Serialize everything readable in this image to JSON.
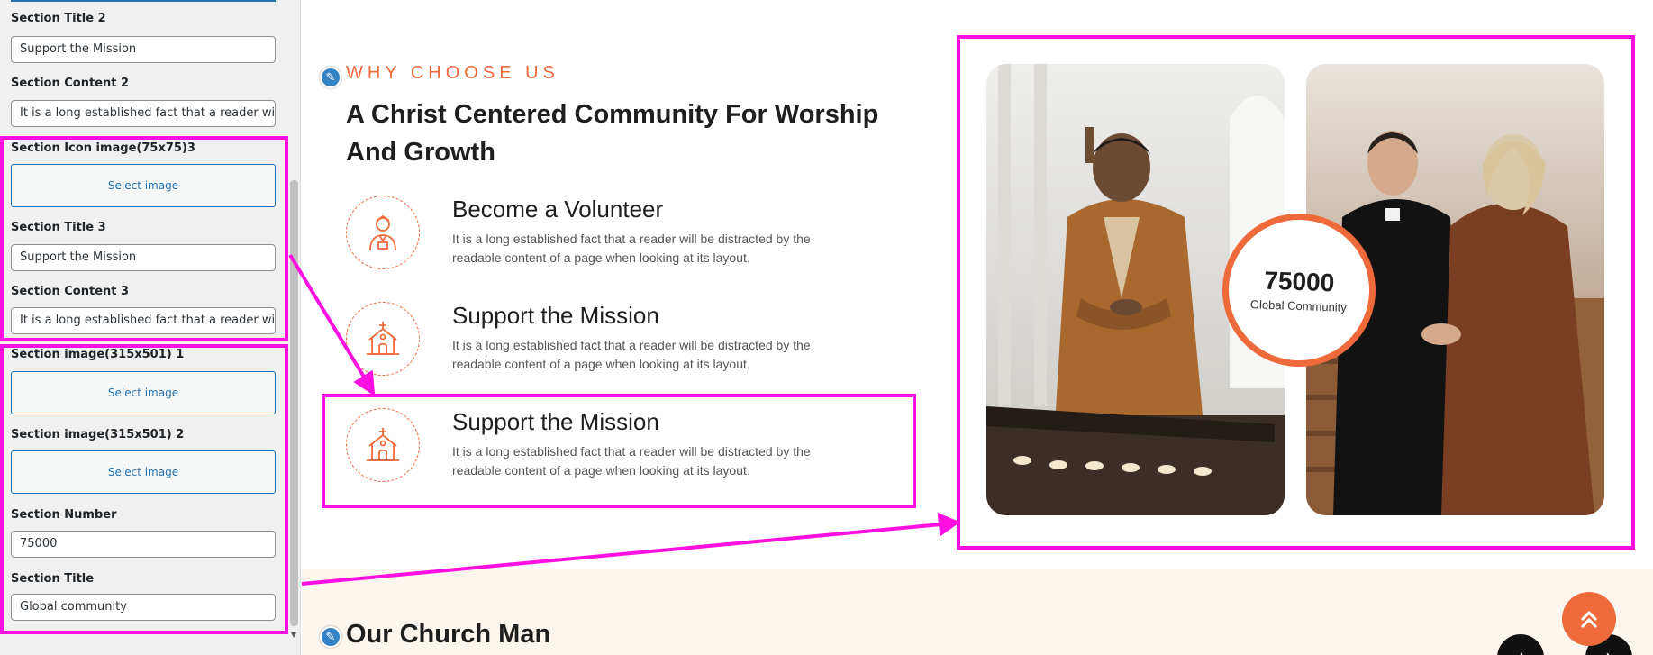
{
  "panel": {
    "fields": [
      {
        "label": "Section Title 2",
        "value": "Support the Mission"
      },
      {
        "label": "Section Content 2",
        "value": "It is a long established fact that a reader will be distracted"
      },
      {
        "label": "Section Icon image(75x75)3",
        "button": "Select image"
      },
      {
        "label": "Section Title 3",
        "value": "Support the Mission"
      },
      {
        "label": "Section Content 3",
        "value": "It is a long established fact that a reader will be distracted"
      },
      {
        "label": "Section image(315x501) 1",
        "button": "Select image"
      },
      {
        "label": "Section image(315x501) 2",
        "button": "Select image"
      },
      {
        "label": "Section Number",
        "value": "75000"
      },
      {
        "label": "Section Title",
        "value": "Global community"
      }
    ]
  },
  "preview": {
    "kicker": "WHY CHOOSE US",
    "heading": "A Christ Centered Community For Worship And Growth",
    "features": [
      {
        "title": "Become a Volunteer",
        "text": "It is a long established fact that a reader will be distracted by the readable content of a page when looking at its layout.",
        "icon": "volunteer-icon"
      },
      {
        "title": "Support the Mission",
        "text": "It is a long established fact that a reader will be distracted by the readable content of a page when looking at its layout.",
        "icon": "church-icon"
      },
      {
        "title": "Support the Mission",
        "text": "It is a long established fact that a reader will be distracted by the readable content of a page when looking at its layout.",
        "icon": "church-icon"
      }
    ],
    "stat": {
      "number": "75000",
      "label": "Global Community"
    },
    "next_section_title": "Our Church Man",
    "accent_color": "#ee6a3b",
    "highlight_color": "#ff10e0"
  }
}
